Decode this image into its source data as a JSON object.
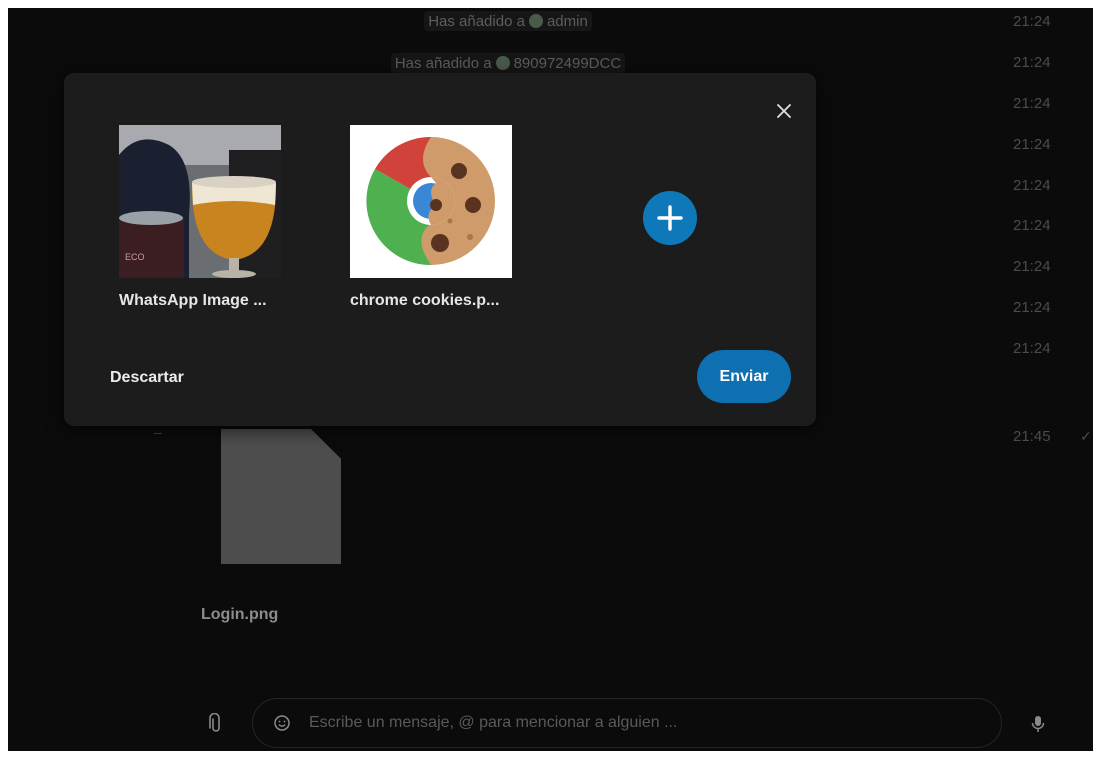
{
  "chat": {
    "system_messages": [
      {
        "prefix": "Has añadido a",
        "name": "admin"
      },
      {
        "prefix": "Has añadido a",
        "name": "890972499DCC"
      }
    ],
    "timestamps": [
      "21:24",
      "21:24",
      "21:24",
      "21:24",
      "21:24",
      "21:24",
      "21:24",
      "21:24",
      "21:24",
      "21:45"
    ],
    "file_message": {
      "filename": "Login.png"
    }
  },
  "dialog": {
    "attachments": [
      {
        "name": "WhatsApp Image ...",
        "thumbnail": "beer-glass-photo"
      },
      {
        "name": "chrome cookies.p...",
        "thumbnail": "chrome-cookie-logo"
      }
    ],
    "discard_label": "Descartar",
    "send_label": "Enviar",
    "add_icon": "plus-icon",
    "close_icon": "close-icon"
  },
  "composer": {
    "placeholder": "Escribe un mensaje, @ para mencionar a alguien ..."
  },
  "colors": {
    "accent": "#0e78b8",
    "dialog_bg": "#1c1c1c",
    "app_bg": "#0b0b0b"
  }
}
